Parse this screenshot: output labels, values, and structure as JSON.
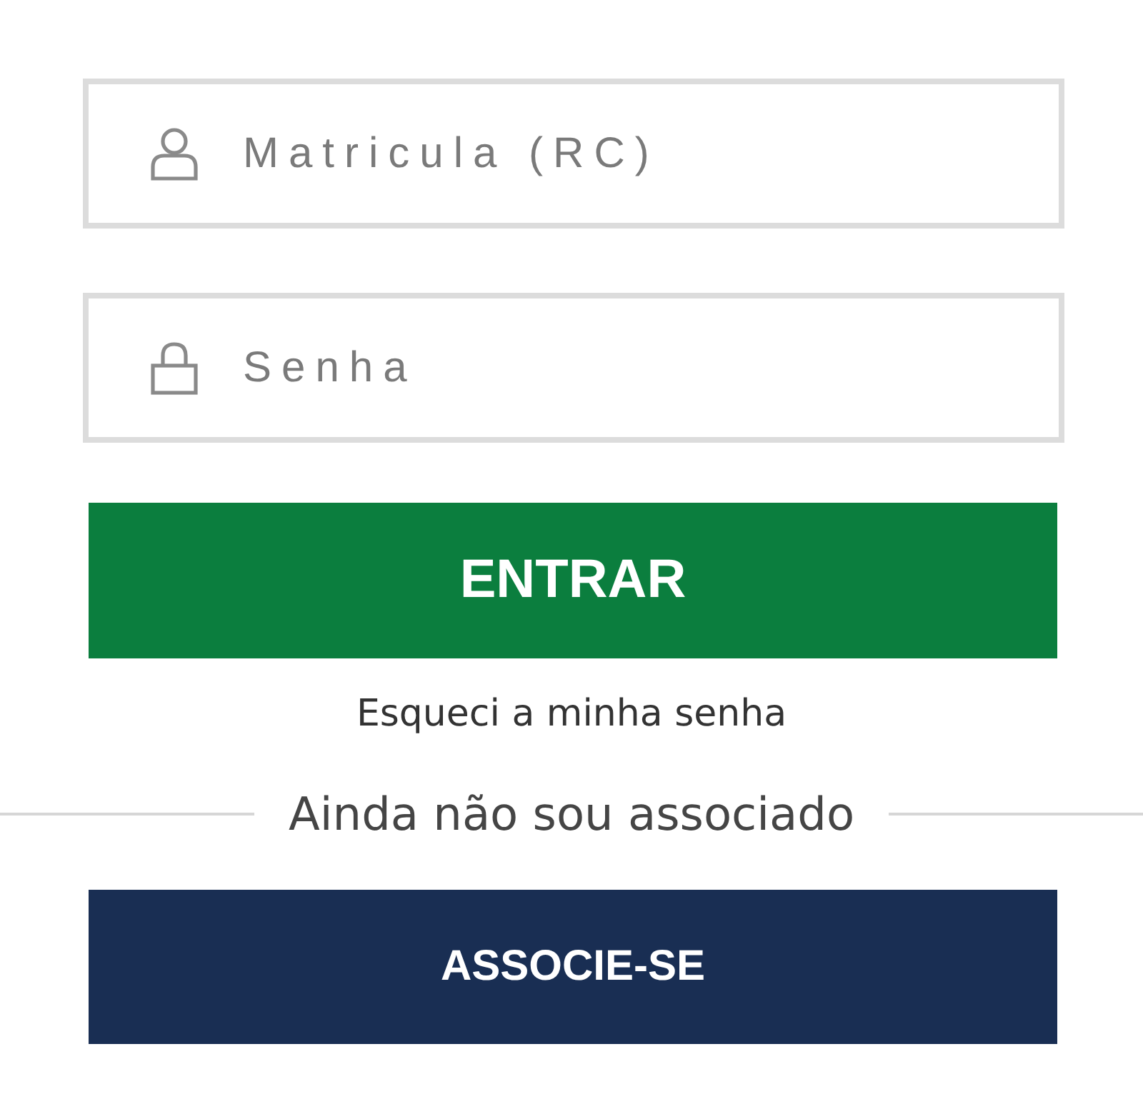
{
  "fields": [
    {
      "kind": "user",
      "placeholder": "Matricula (RC)"
    },
    {
      "kind": "password",
      "placeholder": "Senha"
    }
  ],
  "login_button": {
    "label": "ENTRAR"
  },
  "forgot_link": "Esqueci a minha senha",
  "divider_text": "Ainda não sou associado",
  "signup_button": {
    "label": "ASSOCIE-SE"
  }
}
